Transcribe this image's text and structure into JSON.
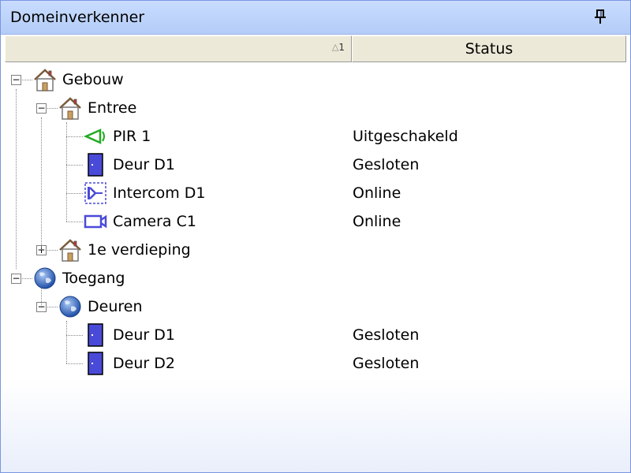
{
  "panel": {
    "title": "Domeinverkenner"
  },
  "header": {
    "col1_sort_number": "1",
    "col2_label": "Status"
  },
  "tree": [
    {
      "label": "Gebouw",
      "status": "",
      "icon": "building-icon",
      "level": 0,
      "expander": "minus"
    },
    {
      "label": "Entree",
      "status": "",
      "icon": "building-icon",
      "level": 1,
      "expander": "minus"
    },
    {
      "label": "PIR 1",
      "status": "Uitgeschakeld",
      "icon": "pir-sensor-icon",
      "level": 2
    },
    {
      "label": "Deur D1",
      "status": "Gesloten",
      "icon": "door-icon",
      "level": 2
    },
    {
      "label": "Intercom D1",
      "status": "Online",
      "icon": "intercom-icon",
      "level": 2
    },
    {
      "label": "Camera C1",
      "status": "Online",
      "icon": "camera-icon",
      "level": 2
    },
    {
      "label": "1e verdieping",
      "status": "",
      "icon": "building-icon",
      "level": 1,
      "expander": "plus"
    },
    {
      "label": "Toegang",
      "status": "",
      "icon": "globe-icon",
      "level": 0,
      "expander": "minus"
    },
    {
      "label": "Deuren",
      "status": "",
      "icon": "globe-icon",
      "level": 1,
      "expander": "minus"
    },
    {
      "label": "Deur D1",
      "status": "Gesloten",
      "icon": "door-icon",
      "level": 2
    },
    {
      "label": "Deur D2",
      "status": "Gesloten",
      "icon": "door-icon",
      "level": 2
    }
  ],
  "colors": {
    "titlebar": "#b9d1f8",
    "pir": "#22aa22",
    "device": "#4a4ad8"
  }
}
